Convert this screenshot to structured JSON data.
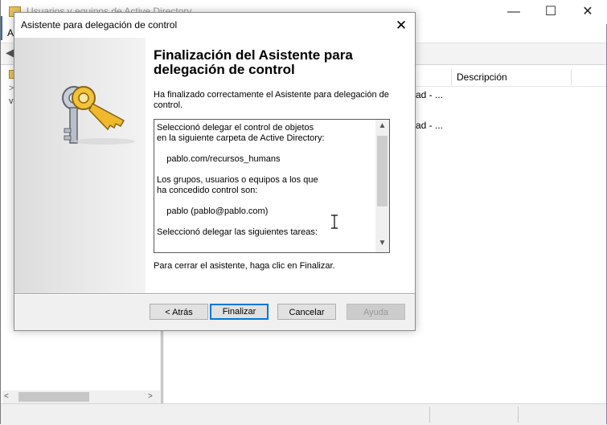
{
  "background_window": {
    "title": "Usuarios y equipos de Active Directory",
    "menu_first": "A",
    "column_header": "Descripción",
    "rows": [
      "ad - ...",
      "ad - ..."
    ],
    "minimize_glyph": "—",
    "maximize_glyph": "☐",
    "close_glyph": "✕",
    "hscroll_left": "<",
    "hscroll_right": ">",
    "tree_chevron_collapsed": ">",
    "tree_chevron_expanded": "v"
  },
  "dialog": {
    "title": "Asistente para delegación de control",
    "close_glyph": "✕",
    "heading": "Finalización del Asistente para delegación de control",
    "intro": "Ha finalizado correctamente el Asistente para delegación de control.",
    "summary_lines": [
      "Seleccionó delegar el control de objetos",
      "en la siguiente carpeta de Active Directory:",
      "",
      "    pablo.com/recursos_humans",
      "",
      "Los grupos, usuarios o equipos a los que",
      "ha concedido control son:",
      "",
      "    pablo (pablo@pablo.com)",
      "",
      "Seleccionó delegar las siguientes tareas:"
    ],
    "footer_text": "Para cerrar el asistente, haga clic en Finalizar.",
    "buttons": {
      "back": "< Atrás",
      "finish": "Finalizar",
      "cancel": "Cancelar",
      "help": "Ayuda"
    },
    "help_enabled": false
  },
  "icons": {
    "banner": "keys-icon",
    "text_cursor": "i-beam-cursor-icon",
    "scroll_up": "chevron-up-icon",
    "scroll_down": "chevron-down-icon"
  },
  "colors": {
    "focus_border": "#0078d7",
    "dialog_bg": "#f0f0f0"
  }
}
